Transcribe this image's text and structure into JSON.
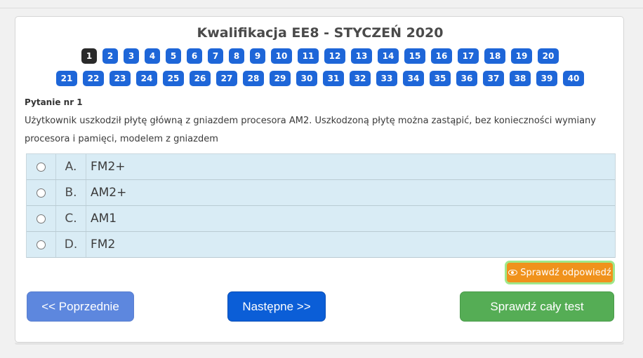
{
  "quiz": {
    "title": "Kwalifikacja EE8 - STYCZEŃ 2020",
    "question_numbers_row1": [
      "1",
      "2",
      "3",
      "4",
      "5",
      "6",
      "7",
      "8",
      "9",
      "10",
      "11",
      "12",
      "13",
      "14",
      "15",
      "16",
      "17",
      "18",
      "19",
      "20"
    ],
    "question_numbers_row2": [
      "21",
      "22",
      "23",
      "24",
      "25",
      "26",
      "27",
      "28",
      "29",
      "30",
      "31",
      "32",
      "33",
      "34",
      "35",
      "36",
      "37",
      "38",
      "39",
      "40"
    ],
    "active_question": "1",
    "question_label": "Pytanie nr 1",
    "question_text": "Użytkownik uszkodził płytę główną z gniazdem procesora AM2. Uszkodzoną płytę można zastąpić, bez konieczności wymiany procesora i pamięci, modelem z gniazdem",
    "answers": [
      {
        "letter": "A.",
        "text": "FM2+"
      },
      {
        "letter": "B.",
        "text": "AM2+"
      },
      {
        "letter": "C.",
        "text": "AM1"
      },
      {
        "letter": "D.",
        "text": "FM2"
      }
    ],
    "check_answer_label": "Sprawdź odpowiedź",
    "prev_label": "<< Poprzednie",
    "next_label": "Następne >>",
    "check_all_label": "Sprawdź cały test"
  },
  "colors": {
    "question_button": "#1e66d8",
    "active_question_button": "#2a2a2a",
    "answer_background": "#d9ecf5",
    "check_answer": "#f0921c",
    "prev_button": "#5d87de",
    "next_button": "#0b5ed7",
    "check_all_button": "#55ad55"
  }
}
